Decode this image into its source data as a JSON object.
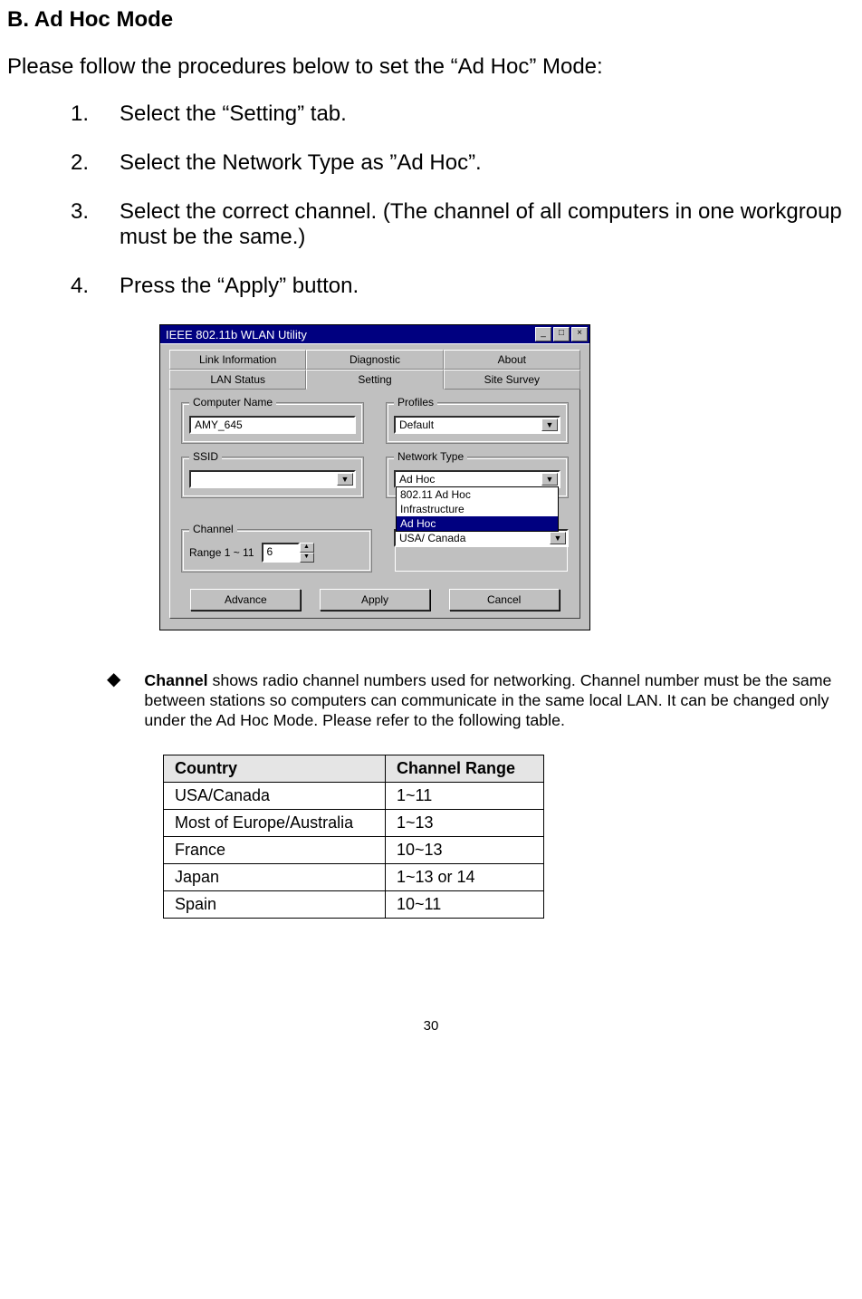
{
  "section_title": "B. Ad Hoc Mode",
  "intro": "Please follow the procedures below to set the “Ad Hoc” Mode:",
  "steps": [
    "Select the “Setting” tab.",
    "Select the Network Type as ”Ad Hoc”.",
    "Select the correct channel. (The channel of all computers in one workgroup must be the same.)",
    "Press the “Apply” button."
  ],
  "dialog": {
    "title": "IEEE 802.11b WLAN Utility",
    "tabs_row1": [
      "Link Information",
      "Diagnostic",
      "About"
    ],
    "tabs_row2": [
      "LAN Status",
      "Setting",
      "Site Survey"
    ],
    "active_tab": "Setting",
    "groups": {
      "computer_name": {
        "label": "Computer Name",
        "value": "AMY_645"
      },
      "profiles": {
        "label": "Profiles",
        "value": "Default"
      },
      "ssid": {
        "label": "SSID",
        "value": ""
      },
      "network_type": {
        "label": "Network Type",
        "value": "Ad Hoc",
        "options": [
          "802.11 Ad Hoc",
          "Infrastructure",
          "Ad Hoc"
        ],
        "highlighted": "Ad Hoc"
      },
      "channel": {
        "label": "Channel",
        "range_label": "Range 1 ~ 11",
        "value": "6"
      },
      "country": {
        "label": "",
        "value": "USA/ Canada"
      }
    },
    "buttons": {
      "advance": "Advance",
      "apply": "Apply",
      "cancel": "Cancel"
    }
  },
  "bullet": {
    "lead": "Channel",
    "text": " shows radio channel numbers used for networking. Channel number must be the same between stations so computers can communicate in the same local LAN. It can be changed only under the Ad Hoc Mode. Please refer to the following table."
  },
  "channel_table": {
    "headers": [
      "Country",
      "Channel Range"
    ],
    "rows": [
      [
        "USA/Canada",
        "1~11"
      ],
      [
        "Most of Europe/Australia",
        "1~13"
      ],
      [
        "France",
        "10~13"
      ],
      [
        "Japan",
        "1~13 or 14"
      ],
      [
        "Spain",
        "10~11"
      ]
    ]
  },
  "page_number": "30"
}
